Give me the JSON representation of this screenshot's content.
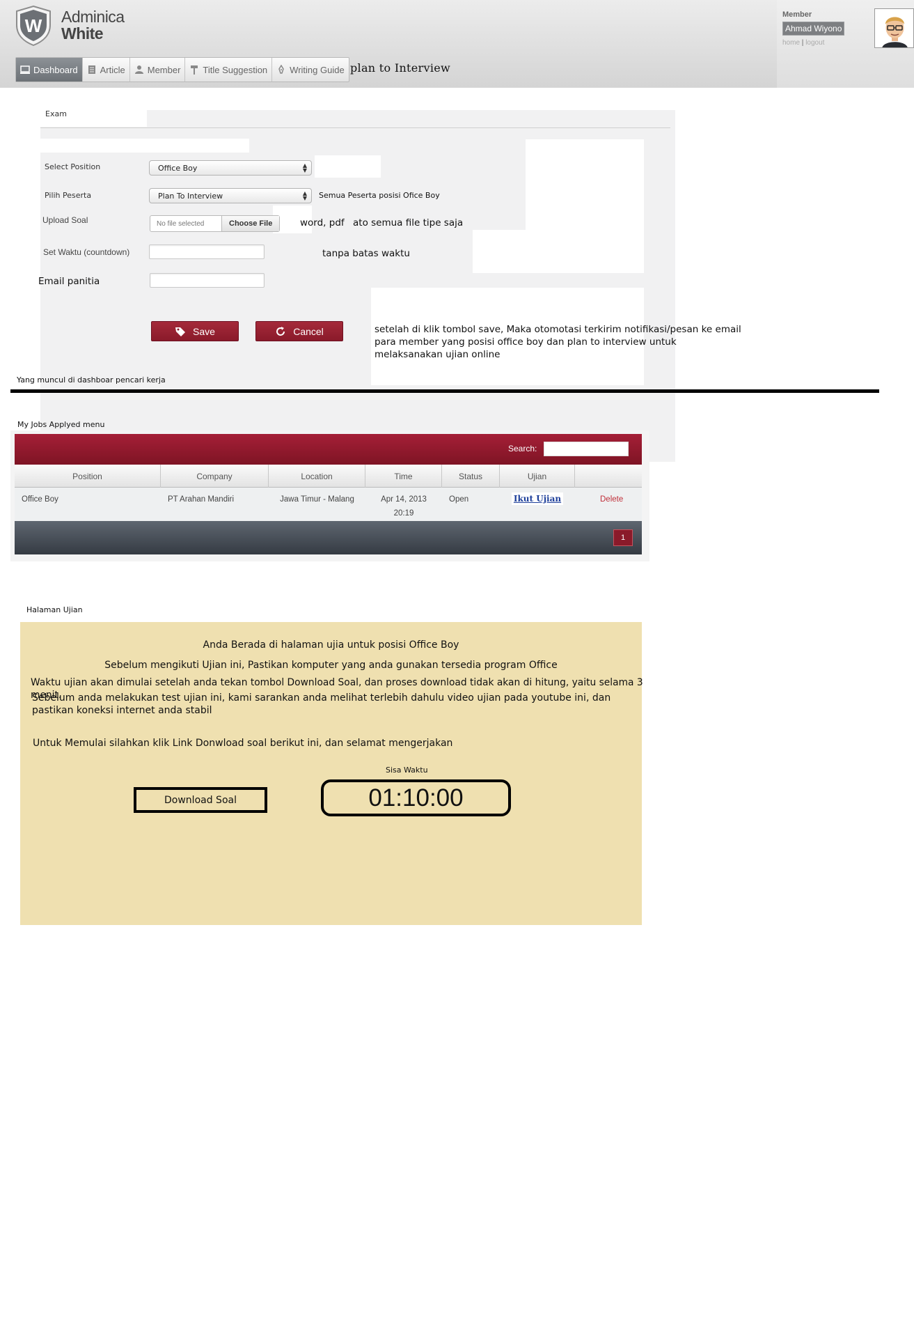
{
  "header": {
    "brand_line1": "Adminica",
    "brand_line2": "White",
    "logo_letter": "W",
    "nav": [
      {
        "label": "Dashboard",
        "icon": "monitor-icon"
      },
      {
        "label": "Article",
        "icon": "document-icon"
      },
      {
        "label": "Member",
        "icon": "user-icon"
      },
      {
        "label": "Title Suggestion",
        "icon": "hammer-icon"
      },
      {
        "label": "Writing Guide",
        "icon": "pen-icon"
      }
    ],
    "page_title": "plan to Interview",
    "member_label": "Member",
    "member_name": "Ahmad Wiyono",
    "link_home": "home",
    "link_logout": "logout"
  },
  "form": {
    "title": "Exam",
    "select_position_label": "Select Position",
    "select_position_value": "Office Boy",
    "pilih_peserta_label": "Pilih Peserta",
    "pilih_peserta_value": "Plan To Interview",
    "pilih_peserta_note": "Semua Peserta posisi Ofice Boy",
    "upload_label": "Upload Soal",
    "file_placeholder": "No file selected",
    "file_button": "Choose File",
    "upload_note_1": "word, pdf",
    "upload_note_2": "ato semua file tipe saja",
    "waktu_label": "Set Waktu (countdown)",
    "waktu_note": "tanpa batas waktu",
    "email_label": "Email panitia",
    "save_label": "Save",
    "cancel_label": "Cancel",
    "save_note": "setelah di klik tombol save, Maka otomotasi terkirim notifikasi/pesan ke email para member yang posisi office boy dan plan to interview untuk melaksanakan ujian online"
  },
  "dashboard_caption": "Yang muncul di dashboar pencari kerja",
  "jobs": {
    "caption": "My Jobs Applyed menu",
    "search_label": "Search:",
    "columns": [
      "Position",
      "Company",
      "Location",
      "Time",
      "Status",
      "Ujian",
      ""
    ],
    "row": {
      "position": "Office Boy",
      "company": "PT Arahan Mandiri",
      "location": "Jawa Timur - Malang",
      "time_date": "Apr 14, 2013",
      "time_clock": "20:19",
      "status": "Open",
      "ujian": "Ikut Ujian",
      "action": "Delete"
    },
    "page": "1"
  },
  "exam_page": {
    "caption": "Halaman Ujian",
    "line1": "Anda Berada di halaman ujia untuk posisi Office Boy",
    "line2": "Sebelum mengikuti Ujian ini, Pastikan komputer yang anda gunakan tersedia program Office",
    "line3": "Waktu ujian akan dimulai setelah anda tekan tombol Download Soal, dan proses download tidak akan di hitung, yaitu selama 3 menit.",
    "line4": "Sebelum anda melakukan test ujian ini, kami sarankan anda melihat terlebih dahulu video ujian pada youtube ini, dan pastikan koneksi internet anda stabil",
    "line5": "Untuk Memulai silahkan klik Link Donwload soal berikut ini, dan selamat mengerjakan",
    "sisa_label": "Sisa Waktu",
    "download_label": "Download Soal",
    "timer": "01:10:00"
  },
  "colors": {
    "accent_red": "#8a1a2a",
    "exam_bg": "#efe0b0",
    "link_blue": "#1d3f9a"
  }
}
